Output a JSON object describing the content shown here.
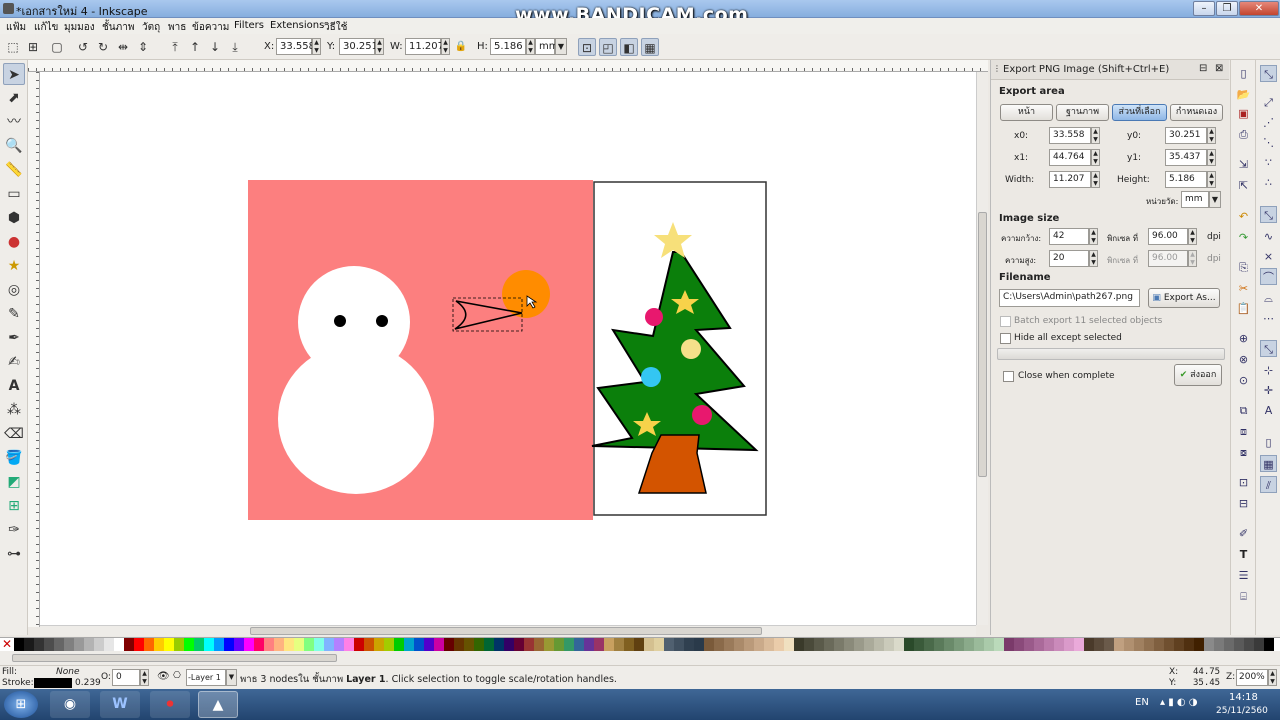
{
  "window": {
    "title": "*เอกสารใหม่ 4 - Inkscape",
    "min": "–",
    "max": "❐",
    "close": "✕"
  },
  "watermark": "www.BANDICAM.com",
  "menu": [
    "แฟ้ม",
    "แก้ไข",
    "มุมมอง",
    "ชั้นภาพ",
    "วัตถุ",
    "พาธ",
    "ข้อความ",
    "Filters",
    "Extensions",
    "วิธีใช้"
  ],
  "toolbar": {
    "x_label": "X:",
    "x": "33.558",
    "y_label": "Y:",
    "y": "30.251",
    "w_label": "W:",
    "w": "11.207",
    "h_label": "H:",
    "h": "5.186",
    "unit": "mm"
  },
  "dock": {
    "title": "Export PNG Image (Shift+Ctrl+E)",
    "export_area": "Export area",
    "area_buttons": [
      "หน้า",
      "ฐานภาพ",
      "ส่วนที่เลือก",
      "กำหนดเอง"
    ],
    "active_area": "ส่วนที่เลือก",
    "x0_label": "x0:",
    "x0": "33.558",
    "y0_label": "y0:",
    "y0": "30.251",
    "x1_label": "x1:",
    "x1": "44.764",
    "y1_label": "y1:",
    "y1": "35.437",
    "width_label": "Width:",
    "width": "11.207",
    "height_label": "Height:",
    "height": "5.186",
    "units_label": "หน่วยวัด:",
    "units": "mm",
    "image_size": "Image size",
    "px_w_label": "ความกว้าง:",
    "px_w": "42",
    "dpi_label": "พิกเซล ที่",
    "dpi": "96.00",
    "dpi_unit": "dpi",
    "px_h_label": "ความสูง:",
    "px_h": "20",
    "dpi2": "96.00",
    "filename_label": "Filename",
    "filename": "C:\\Users\\Admin\\path267.png",
    "export_as": "Export As...",
    "batch": "Batch export 11 selected objects",
    "hide_all": "Hide all except selected",
    "close_when": "Close when complete",
    "export_btn": "ส่งออก"
  },
  "status": {
    "fill_label": "Fill:",
    "fill_value": "None",
    "stroke_label": "Stroke:",
    "stroke_width": "0.239",
    "opacity_label": "O:",
    "opacity": "0",
    "layer": "-Layer 1",
    "message_pre": "พาธ 3 nodesใน ชั้นภาพ ",
    "message_layer": "Layer 1",
    "message_post": ". Click selection to toggle scale/rotation handles.",
    "cx_label": "X:",
    "cx": "44.75",
    "cy_label": "Y:",
    "cy": "35.45",
    "zoom_label": "Z:",
    "zoom": "200%"
  },
  "taskbar": {
    "lang": "EN",
    "time": "14:18",
    "date": "25/11/2560"
  },
  "colors": {
    "accent": "#4a79b4",
    "canvas_pink": "#fc7f7f",
    "tree_green": "#0b7f0b",
    "trunk": "#d35400"
  }
}
